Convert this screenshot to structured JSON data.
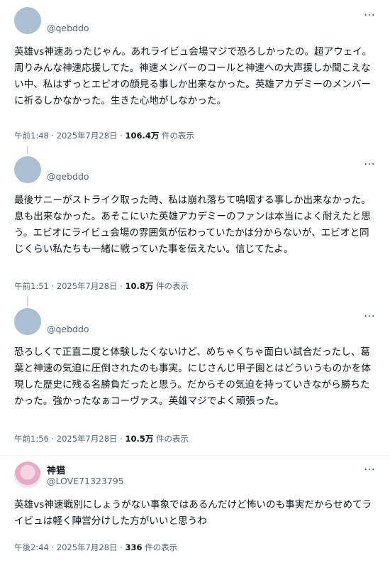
{
  "tweets": [
    {
      "handle": "@qebddo",
      "text": "英雄vs神速あったじゃん。あれライビュ会場マジで恐ろしかったの。超アウェイ。周りみんな神速応援してた。神速メンバーのコールと神速への大声援しか聞こえない中、私はずっとエビオの顔見る事しか出来なかった。英雄アカデミーのメンバーに祈るしかなかった。生きた心地がしなかった。",
      "time": "午前1:48 · 2025年7月28日 · ",
      "views": "106.4万",
      "views_label": " 件の表示"
    },
    {
      "handle": "@qebddo",
      "text": "最後サニーがストライク取った時、私は崩れ落ちて嗚咽する事しか出来なかった。息も出来なかった。あそこにいた英雄アカデミーのファンは本当によく耐えたと思う。エビオにライビュ会場の雰囲気が伝わっていたかは分からないが、エビオと同じくらい私たちも一緒に戦っていた事を伝えたい。信じてたよ。",
      "time": "午前1:51 · 2025年7月28日 · ",
      "views": "10.8万",
      "views_label": " 件の表示"
    },
    {
      "handle": "@qebddo",
      "text": "恐ろしくて正直二度と体験したくないけど、めちゃくちゃ面白い試合だったし、葛葉と神速の気迫に圧倒されたのも事実。にじさんじ甲子園とはどういうものかを体現した歴史に残る名勝負だったと思う。だからその気迫を持っていきながら勝ちたかった。強かったなぁコーヴァス。英雄マジでよく頑張った。",
      "time": "午前1:56 · 2025年7月28日 · ",
      "views": "10.5万",
      "views_label": " 件の表示"
    },
    {
      "name": "神猫",
      "handle": "@LOVE71323795",
      "text": "英雄vs神速戦別にしょうがない事象ではあるんだけど怖いのも事実だからせめてライビュは軽く陣営分けした方がいいと思うわ",
      "time": "午後2:44 · 2025年7月28日 · ",
      "views": "336",
      "views_label": " 件の表示"
    }
  ],
  "more_icon": "⋯"
}
